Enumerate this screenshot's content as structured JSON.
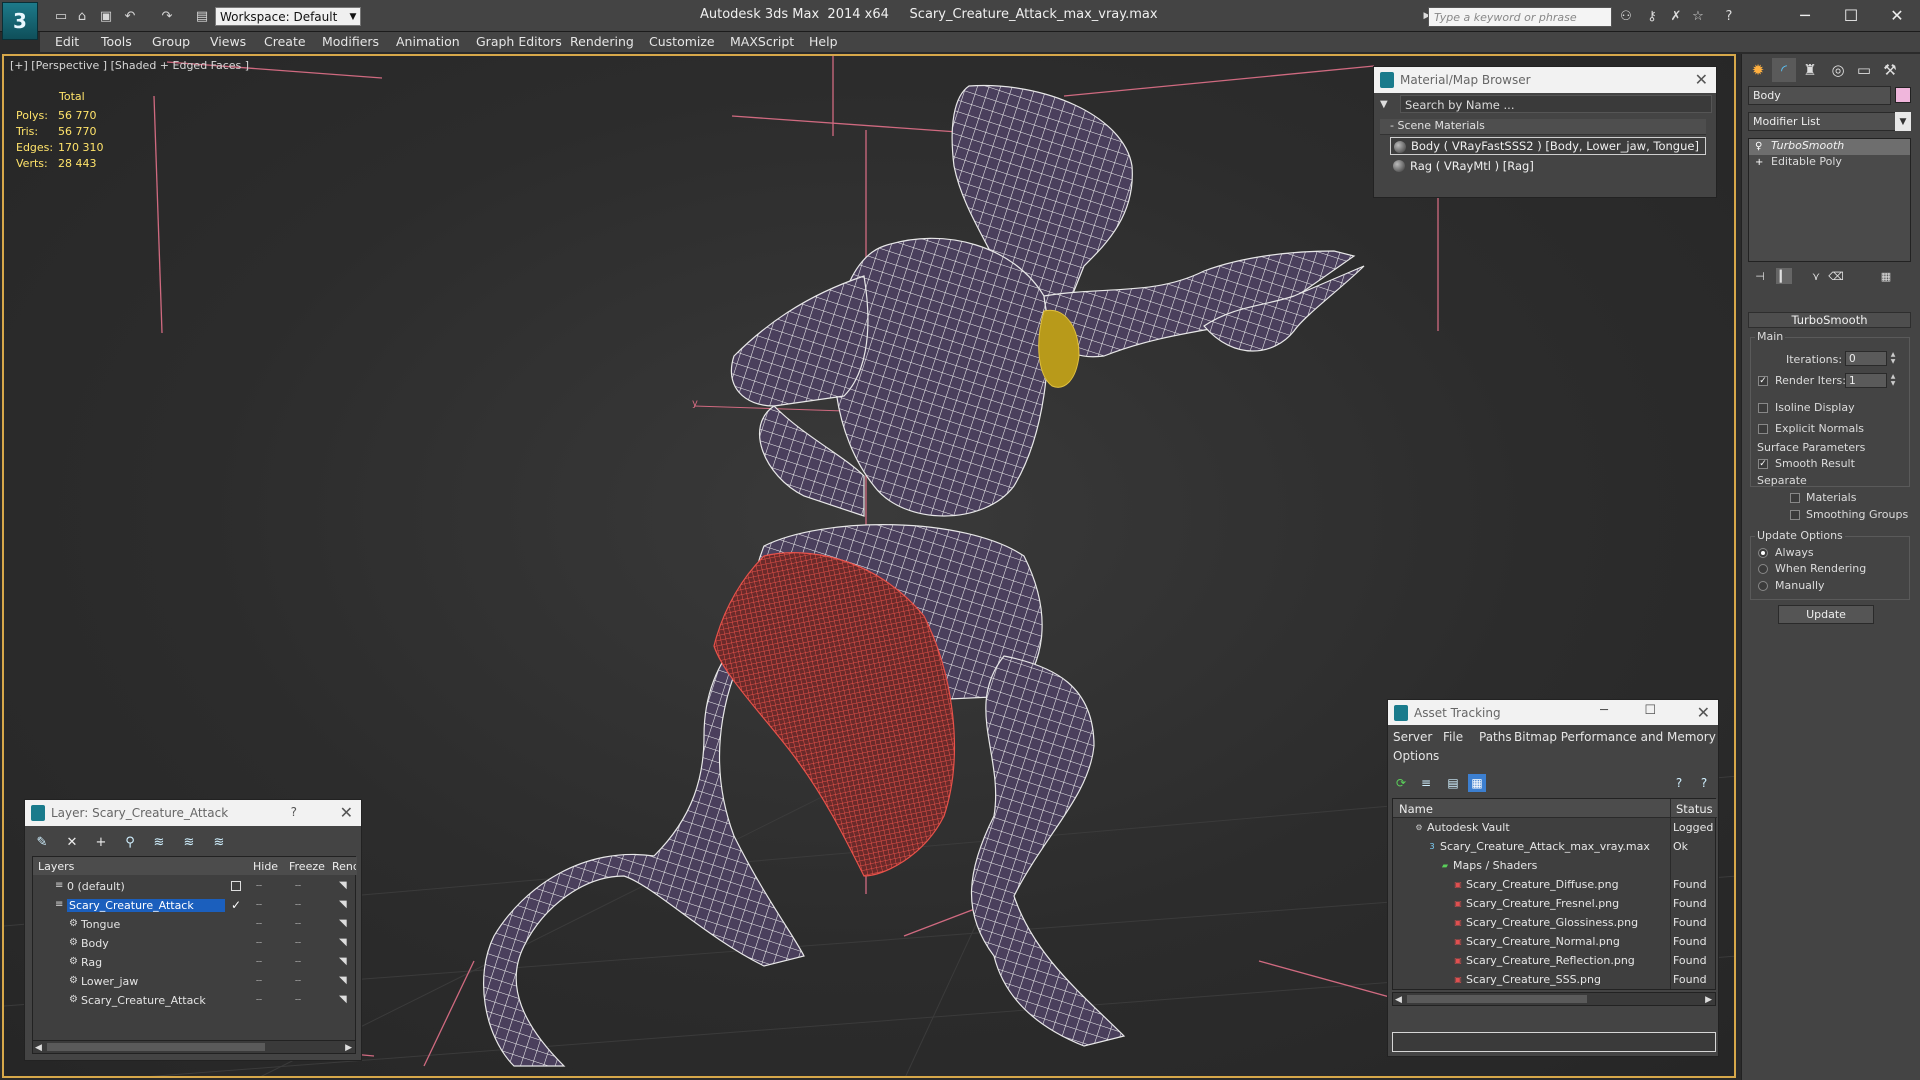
{
  "titlebar": {
    "logo": "3",
    "workspace": "Workspace: Default",
    "title": "Autodesk 3ds Max  2014 x64     Scary_Creature_Attack_max_vray.max",
    "search_placeholder": "Type a keyword or phrase"
  },
  "menu": [
    "Edit",
    "Tools",
    "Group",
    "Views",
    "Create",
    "Modifiers",
    "Animation",
    "Graph Editors",
    "Rendering",
    "Customize",
    "MAXScript",
    "Help"
  ],
  "viewport": {
    "label": "[+] [Perspective ] [Shaded + Edged Faces ]",
    "stats": {
      "total_label": "Total",
      "rows": [
        {
          "label": "Polys:",
          "value": "56 770"
        },
        {
          "label": "Tris:",
          "value": "56 770"
        },
        {
          "label": "Edges:",
          "value": "170 310"
        },
        {
          "label": "Verts:",
          "value": "28 443"
        }
      ]
    },
    "axis_label": "y"
  },
  "material_browser": {
    "title": "Material/Map Browser",
    "search_placeholder": "Search by Name ...",
    "group": "- Scene Materials",
    "materials": [
      "Body  ( VRayFastSSS2 ) [Body, Lower_jaw, Tongue]",
      "Rag  ( VRayMtl ) [Rag]"
    ]
  },
  "command_panel": {
    "object_name": "Body",
    "object_color": "#f0b6dc",
    "modifier_list": "Modifier List",
    "stack": [
      "TurboSmooth",
      "Editable Poly"
    ],
    "rollout_title": "TurboSmooth",
    "main_label": "Main",
    "iterations_label": "Iterations:",
    "iterations_value": "0",
    "render_iters_label": "Render Iters:",
    "render_iters_value": "1",
    "isoline_label": "Isoline Display",
    "explicit_normals_label": "Explicit Normals",
    "surface_params_label": "Surface Parameters",
    "smooth_result_label": "Smooth Result",
    "separate_label": "Separate",
    "materials_label": "Materials",
    "smoothing_groups_label": "Smoothing Groups",
    "update_options_label": "Update Options",
    "always_label": "Always",
    "when_rendering_label": "When Rendering",
    "manually_label": "Manually",
    "update_button": "Update"
  },
  "asset_tracking": {
    "title": "Asset Tracking",
    "menu": [
      "Server",
      "File",
      "Paths",
      "Bitmap Performance and Memory",
      "Options"
    ],
    "col_name": "Name",
    "col_status": "Status",
    "rows": [
      {
        "name": "Autodesk Vault",
        "status": "Logged Out",
        "indent": 1,
        "icon": "vault"
      },
      {
        "name": "Scary_Creature_Attack_max_vray.max",
        "status": "Ok",
        "indent": 2,
        "icon": "max"
      },
      {
        "name": "Maps / Shaders",
        "status": "",
        "indent": 3,
        "icon": "folder"
      },
      {
        "name": "Scary_Creature_Diffuse.png",
        "status": "Found",
        "indent": 4,
        "icon": "png"
      },
      {
        "name": "Scary_Creature_Fresnel.png",
        "status": "Found",
        "indent": 4,
        "icon": "png"
      },
      {
        "name": "Scary_Creature_Glossiness.png",
        "status": "Found",
        "indent": 4,
        "icon": "png"
      },
      {
        "name": "Scary_Creature_Normal.png",
        "status": "Found",
        "indent": 4,
        "icon": "png"
      },
      {
        "name": "Scary_Creature_Reflection.png",
        "status": "Found",
        "indent": 4,
        "icon": "png"
      },
      {
        "name": "Scary_Creature_SSS.png",
        "status": "Found",
        "indent": 4,
        "icon": "png"
      }
    ]
  },
  "layer_panel": {
    "title": "Layer: Scary_Creature_Attack",
    "help": "?",
    "col_layers": "Layers",
    "col_hide": "Hide",
    "col_freeze": "Freeze",
    "col_render": "Render",
    "rows": [
      {
        "name": "0 (default)",
        "indent": 1
      },
      {
        "name": "Scary_Creature_Attack",
        "indent": 1
      },
      {
        "name": "Tongue",
        "indent": 2
      },
      {
        "name": "Body",
        "indent": 2
      },
      {
        "name": "Rag",
        "indent": 2
      },
      {
        "name": "Lower_jaw",
        "indent": 2
      },
      {
        "name": "Scary_Creature_Attack",
        "indent": 2
      }
    ]
  }
}
